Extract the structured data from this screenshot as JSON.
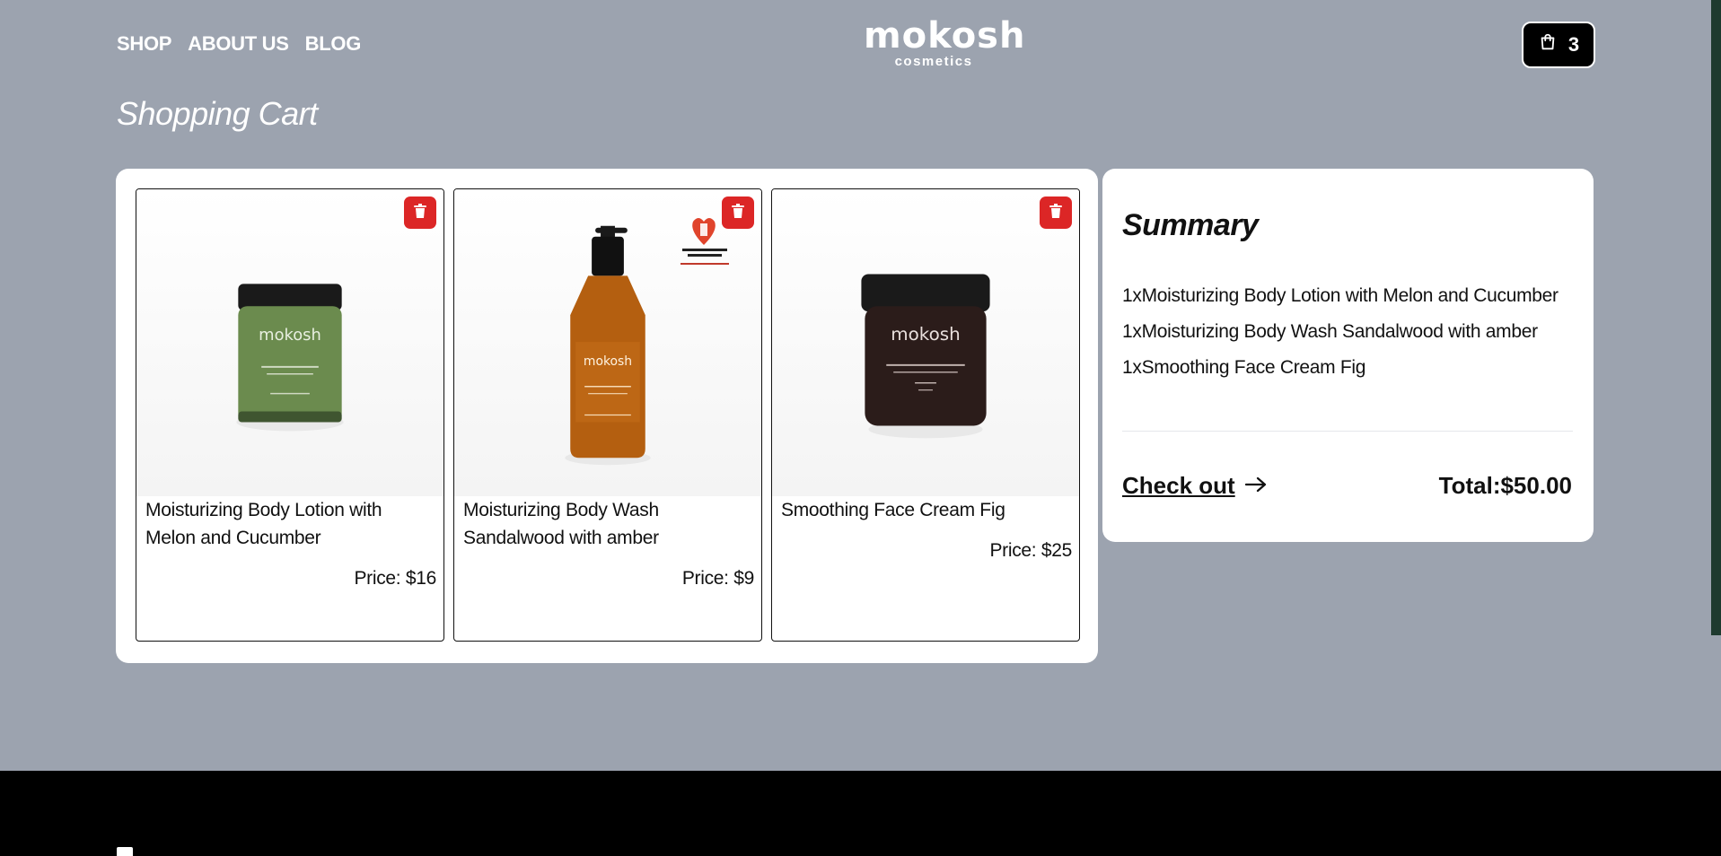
{
  "nav": {
    "items": [
      "SHOP",
      "ABOUT US",
      "BLOG"
    ]
  },
  "logo": {
    "main": "mokosh",
    "sub": "cosmetics"
  },
  "cart": {
    "count": "3",
    "icon": "shopping-bag-icon"
  },
  "page": {
    "title": "Shopping Cart"
  },
  "products": [
    {
      "name": "Moisturizing Body Lotion with Melon and Cucumber",
      "price": "Price: $16",
      "jar_color": "#6b8b4e",
      "image_label": "mokosh"
    },
    {
      "name": "Moisturizing Body Wash Sandalwood with amber",
      "price": "Price: $9",
      "bottle_color": "#b45f10",
      "image_label": "mokosh",
      "badge": "LOVE COSMETICS AWARDS"
    },
    {
      "name": "Smoothing Face Cream Fig",
      "price": "Price: $25",
      "jar_color": "#2b1c1a",
      "image_label": "mokosh"
    }
  ],
  "summary": {
    "title": "Summary",
    "items": [
      "1xMoisturizing Body Lotion with Melon and Cucumber",
      "1xMoisturizing Body Wash Sandalwood with amber",
      "1xSmoothing Face Cream Fig"
    ],
    "checkout_label": "Check out",
    "total": "Total:$50.00"
  },
  "colors": {
    "background": "#9ca3af",
    "delete": "#dc2626",
    "footer": "#000000"
  }
}
